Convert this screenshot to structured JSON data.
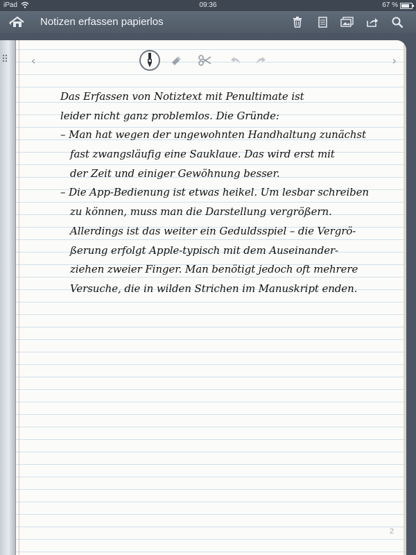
{
  "status_bar": {
    "carrier": "iPad",
    "time": "09:36",
    "battery": "67 %"
  },
  "nav_bar": {
    "title": "Notizen erfassen papierlos",
    "icons": [
      "home-icon",
      "trash-icon",
      "document-icon",
      "photos-icon",
      "share-icon",
      "search-icon"
    ]
  },
  "toolbar": {
    "tools": [
      "pen-icon",
      "eraser-icon",
      "scissors-icon",
      "undo-icon",
      "redo-icon"
    ],
    "active_tool": "pen",
    "prev_page": "‹",
    "next_page": "›"
  },
  "note": {
    "lines": [
      "Das Erfassen von Notiztext mit Penultimate ist",
      "leider nicht ganz problemlos. Die Gründe:",
      "– Man hat wegen der ungewohnten Handhaltung zunächst",
      "fast zwangsläufig eine Sauklaue. Das wird erst mit",
      "der Zeit und einiger Gewöhnung besser.",
      "– Die App-Bedienung ist etwas heikel. Um lesbar schreiben",
      "zu können, muss man die Darstellung vergrößern.",
      "Allerdings ist das weiter ein Geduldsspiel – die Vergrö-",
      "ßerung erfolgt Apple-typisch mit dem Auseinander-",
      "ziehen zweier Finger. Man benötigt jedoch oft mehrere",
      "Versuche, die in wilden Strichen im Manuskript enden."
    ],
    "page_number": "2"
  }
}
